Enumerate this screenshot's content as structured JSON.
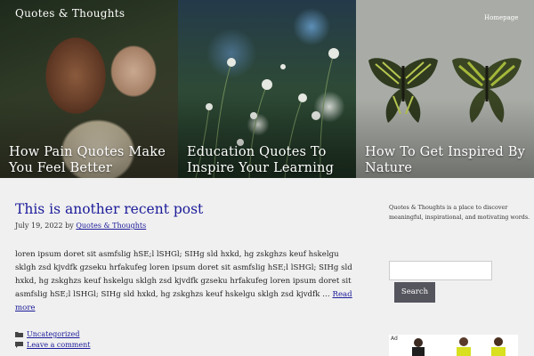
{
  "header": {
    "site_title": "Quotes & Thoughts",
    "nav_home": "Homepage"
  },
  "hero": {
    "panels": [
      {
        "title": "How Pain Quotes Make You Feel Better"
      },
      {
        "title": "Education Quotes To Inspire Your Learning"
      },
      {
        "title": "How To Get Inspired By Nature"
      }
    ]
  },
  "post": {
    "title": "This is another recent post",
    "date": "July 19, 2022",
    "by": "by",
    "author": "Quotes & Thoughts",
    "excerpt": "loren ipsum doret sit asmfslig hSE;l lSHGl; SIHg sld hxkd, hg zskghzs keuf hskelgu sklgh zsd kjvdfk gzseku hrfakufeg loren ipsum doret sit asmfslig hSE;l lSHGl; SIHg sld hxkd, hg zskghzs keuf hskelgu sklgh zsd kjvdfk gzseku hrfakufeg loren ipsum doret sit asmfslig hSE;l lSHGl; SIHg sld hxkd, hg zskghzs keuf hskelgu sklgh zsd kjvdfk …",
    "read_more": "Read more",
    "category": "Uncategorized",
    "comment": "Leave a comment"
  },
  "sidebar": {
    "about": "Quotes & Thoughts is a place to discover meaningful, inspirational, and motivating words.",
    "search_placeholder": "",
    "search_button": "Search",
    "ad_label": "Ad"
  },
  "colors": {
    "link": "#1b1b9a",
    "button": "#55555e",
    "background": "#f0f0f0"
  }
}
